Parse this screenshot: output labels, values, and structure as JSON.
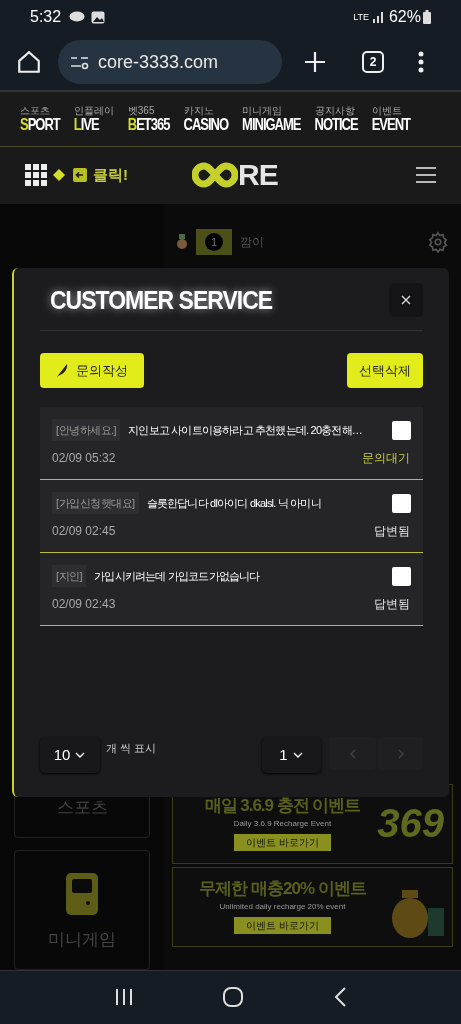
{
  "status_bar": {
    "time": "5:32",
    "network": "LTE",
    "battery": "62%"
  },
  "browser": {
    "url": "core-3333.com",
    "tab_count": "2"
  },
  "nav_menu": [
    {
      "ko": "스포츠",
      "en": "SPORT",
      "highlight_first": true
    },
    {
      "ko": "인플레이",
      "en": "LIVE",
      "highlight_first": true
    },
    {
      "ko": "벳365",
      "en": "BET365",
      "highlight_first": true
    },
    {
      "ko": "카지노",
      "en": "CASINO",
      "highlight_first": false
    },
    {
      "ko": "미니게임",
      "en": "MINIGAME",
      "highlight_first": false
    },
    {
      "ko": "공지사항",
      "en": "NOTICE",
      "highlight_first": false
    },
    {
      "ko": "이벤트",
      "en": "EVENT",
      "highlight_first": false
    }
  ],
  "header": {
    "click_label": "클릭!",
    "logo_text": "RE"
  },
  "user": {
    "rank": "1",
    "name": "깜이"
  },
  "side_menu": [
    {
      "label": "스포츠"
    },
    {
      "label": "미니게임"
    }
  ],
  "banners": [
    {
      "title": "매일 3.6.9 충전 이벤트",
      "subtitle": "Daily 3.6.9 Recharge Event",
      "button": "이벤트 바로가기",
      "art": "369"
    },
    {
      "title": "무제한 매충20% 이벤트",
      "subtitle": "Unlimited daily recharge 20% event",
      "button": "이벤트 바로가기"
    }
  ],
  "modal": {
    "title": "CUSTOMER SERVICE",
    "write_button": "문의작성",
    "delete_button": "선택삭제",
    "inquiries": [
      {
        "tag": "[안녕하세요.]",
        "text": "지인보고 사이트이용하라고 추천했는데. 20충전해…",
        "date": "02/09 05:32",
        "status": "문의대기",
        "answered": false,
        "checked": false
      },
      {
        "tag": "[가입신청햇대요]",
        "text": "슬롯한답니다 dl아이디 dkalsl. 닉 아미니",
        "date": "02/09 02:45",
        "status": "답변됨",
        "answered": true,
        "checked": false
      },
      {
        "tag": "[지인]",
        "text": "가입시키려는데 가입코드가없습니다",
        "date": "02/09 02:43",
        "status": "답변됨",
        "answered": true,
        "checked": false
      }
    ],
    "page_size": "10",
    "page_size_label": "개 씩 표시",
    "page": "1"
  }
}
